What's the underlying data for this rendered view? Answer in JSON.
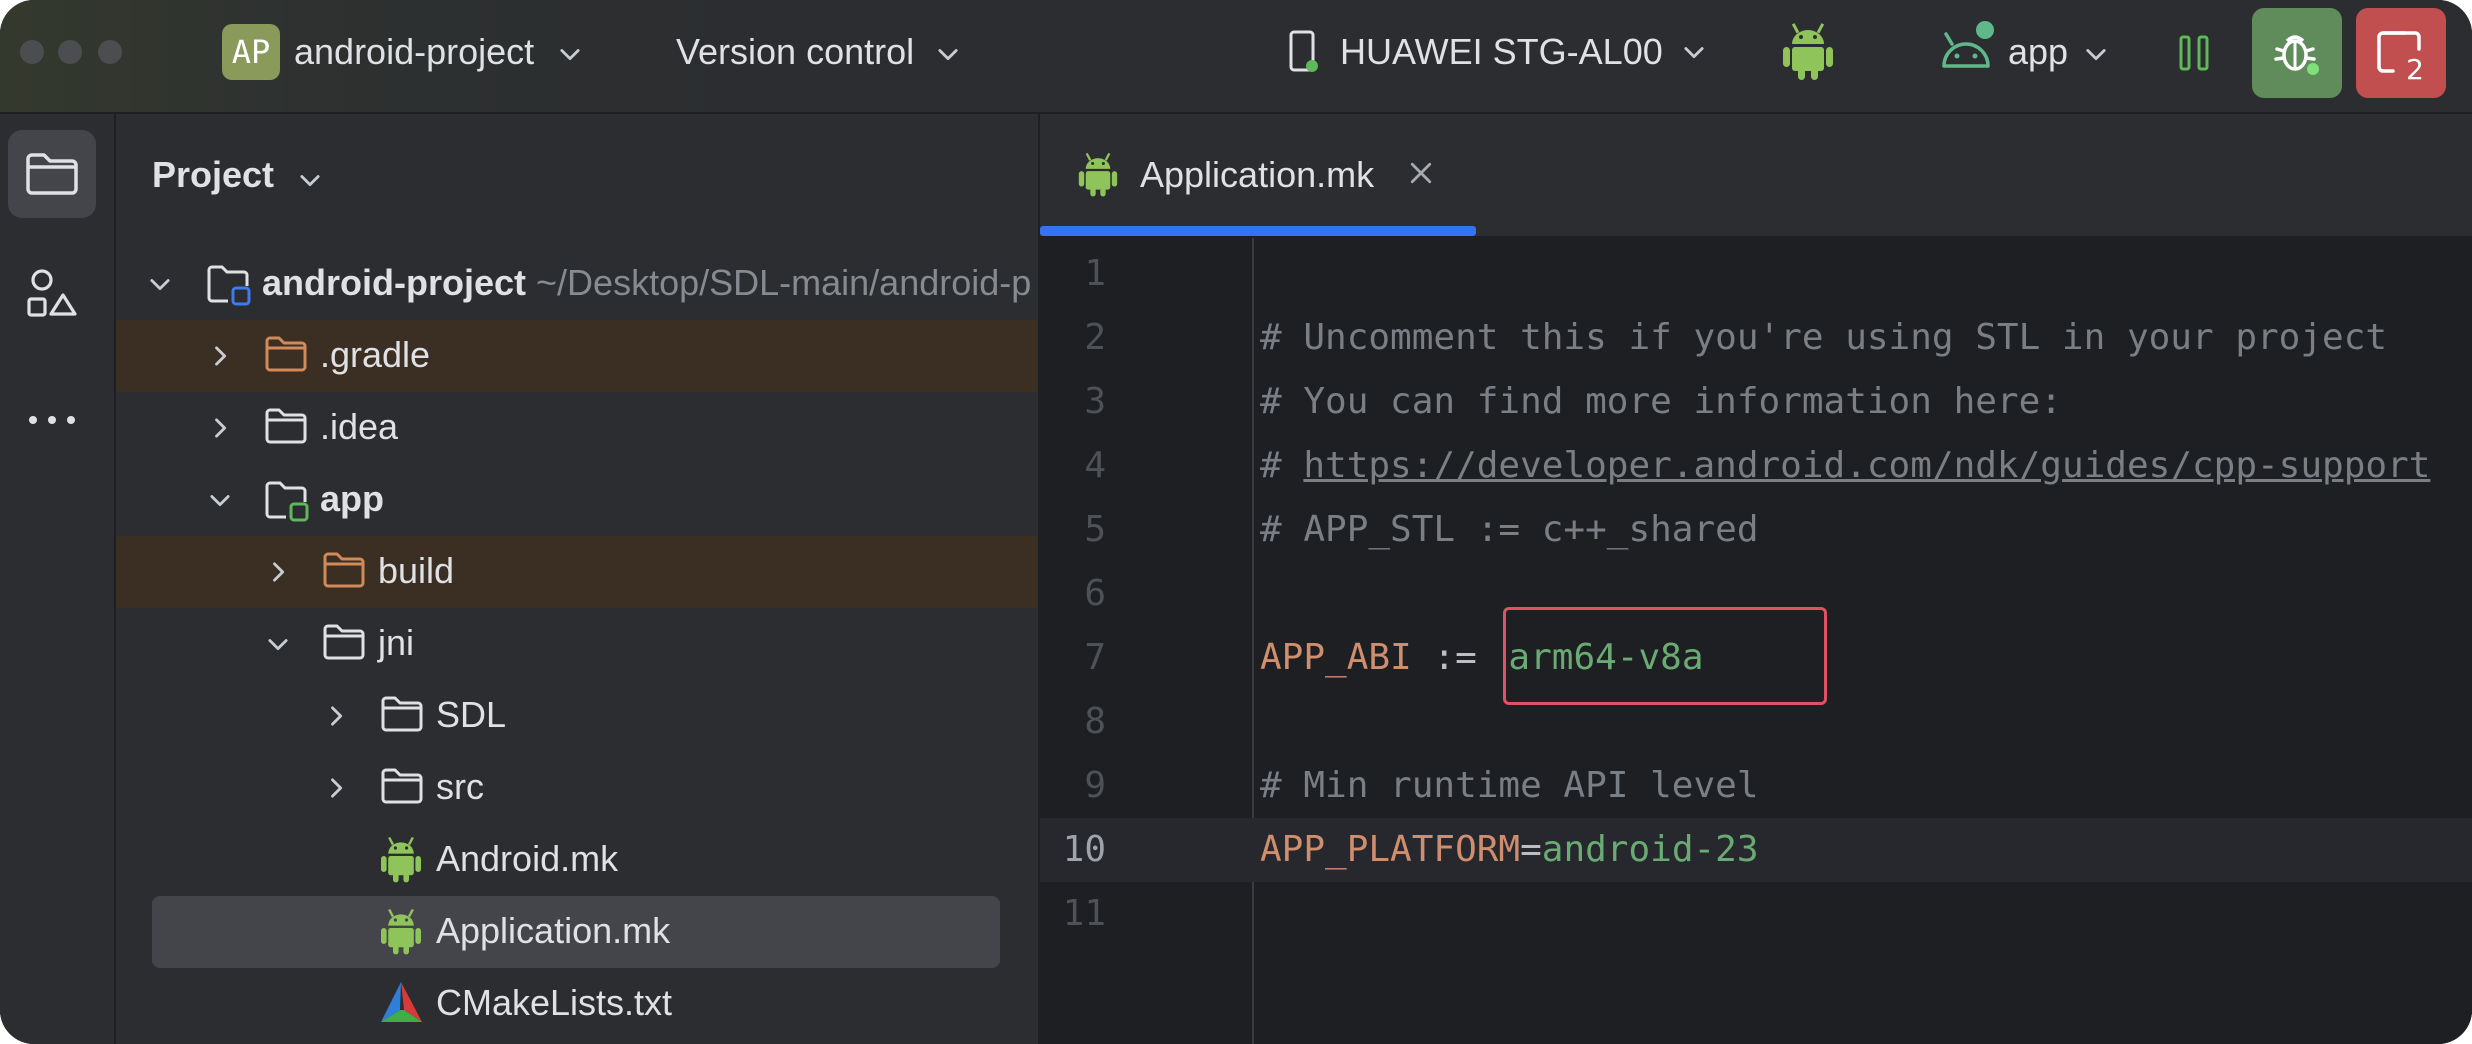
{
  "titlebar": {
    "project_badge": "AP",
    "project_name": "android-project",
    "version_control": "Version control",
    "device_name": "HUAWEI STG-AL00",
    "run_config": "app",
    "device_badge_count": "2"
  },
  "project_panel": {
    "title": "Project",
    "tree": [
      {
        "label": "android-project",
        "path": "~/Desktop/SDL-main/android-p",
        "expanded": true
      },
      {
        "label": ".gradle",
        "expanded": false
      },
      {
        "label": ".idea",
        "expanded": false
      },
      {
        "label": "app",
        "expanded": true
      },
      {
        "label": "build",
        "expanded": false
      },
      {
        "label": "jni",
        "expanded": true
      },
      {
        "label": "SDL",
        "expanded": false
      },
      {
        "label": "src",
        "expanded": false
      },
      {
        "label": "Android.mk"
      },
      {
        "label": "Application.mk",
        "selected": true
      },
      {
        "label": "CMakeLists.txt"
      }
    ]
  },
  "editor": {
    "tab_label": "Application.mk",
    "lines": [
      {
        "n": "1"
      },
      {
        "n": "2",
        "comment": "# Uncomment this if you're using STL in your project"
      },
      {
        "n": "3",
        "comment": "# You can find more information here:"
      },
      {
        "n": "4",
        "hash": "# ",
        "url": "https://developer.android.com/ndk/guides/cpp-support"
      },
      {
        "n": "5",
        "comment": "# APP_STL := c++_shared"
      },
      {
        "n": "6"
      },
      {
        "n": "7",
        "key": "APP_ABI",
        "op": " := ",
        "value": "arm64-v8a"
      },
      {
        "n": "8"
      },
      {
        "n": "9",
        "comment": "# Min runtime API level"
      },
      {
        "n": "10",
        "key": "APP_PLATFORM",
        "op": "=",
        "value": "android-23"
      },
      {
        "n": "11"
      }
    ]
  },
  "colors": {
    "accent": "#3574f0",
    "highlight_box": "#e05263",
    "keyword": "#cf8e6d",
    "string_value": "#6aab73",
    "comment": "#7a7e85",
    "android_green": "#8fc45a",
    "debug_button": "#5f8c5a",
    "device_button": "#c24f4f"
  },
  "icons": [
    "folder-icon",
    "structure-icon",
    "more-icon",
    "android-icon",
    "cmake-icon",
    "phone-icon",
    "debug-bug-icon",
    "device-mirror-icon",
    "pause-icon",
    "chevron-down-icon",
    "chevron-right-icon",
    "close-icon"
  ]
}
